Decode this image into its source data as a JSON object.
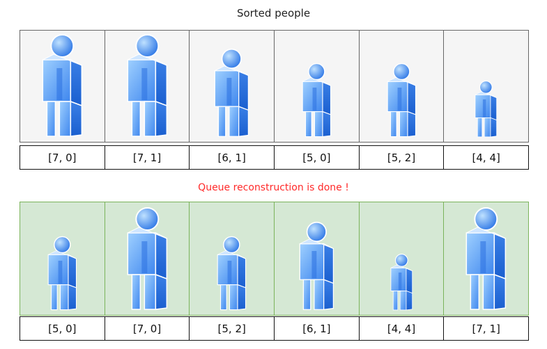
{
  "titles": {
    "top": "Sorted people",
    "middle": "Queue reconstruction is done !"
  },
  "colors": {
    "top_panel_bg": "#f5f5f5",
    "bottom_panel_bg": "#d5e8d4",
    "bottom_panel_border": "#7ab35a",
    "done_text": "#ff2a2a",
    "person_light": "#9fd0ff",
    "person_dark": "#1a5fcf"
  },
  "icons": {
    "person": "person-icon"
  },
  "sorted_people": [
    {
      "label": "[7, 0]",
      "height": 7
    },
    {
      "label": "[7, 1]",
      "height": 7
    },
    {
      "label": "[6, 1]",
      "height": 6
    },
    {
      "label": "[5, 0]",
      "height": 5
    },
    {
      "label": "[5, 2]",
      "height": 5
    },
    {
      "label": "[4, 4]",
      "height": 4
    }
  ],
  "queue": [
    {
      "label": "[5, 0]",
      "height": 5
    },
    {
      "label": "[7, 0]",
      "height": 7
    },
    {
      "label": "[5, 2]",
      "height": 5
    },
    {
      "label": "[6, 1]",
      "height": 6
    },
    {
      "label": "[4, 4]",
      "height": 4
    },
    {
      "label": "[7, 1]",
      "height": 7
    }
  ]
}
